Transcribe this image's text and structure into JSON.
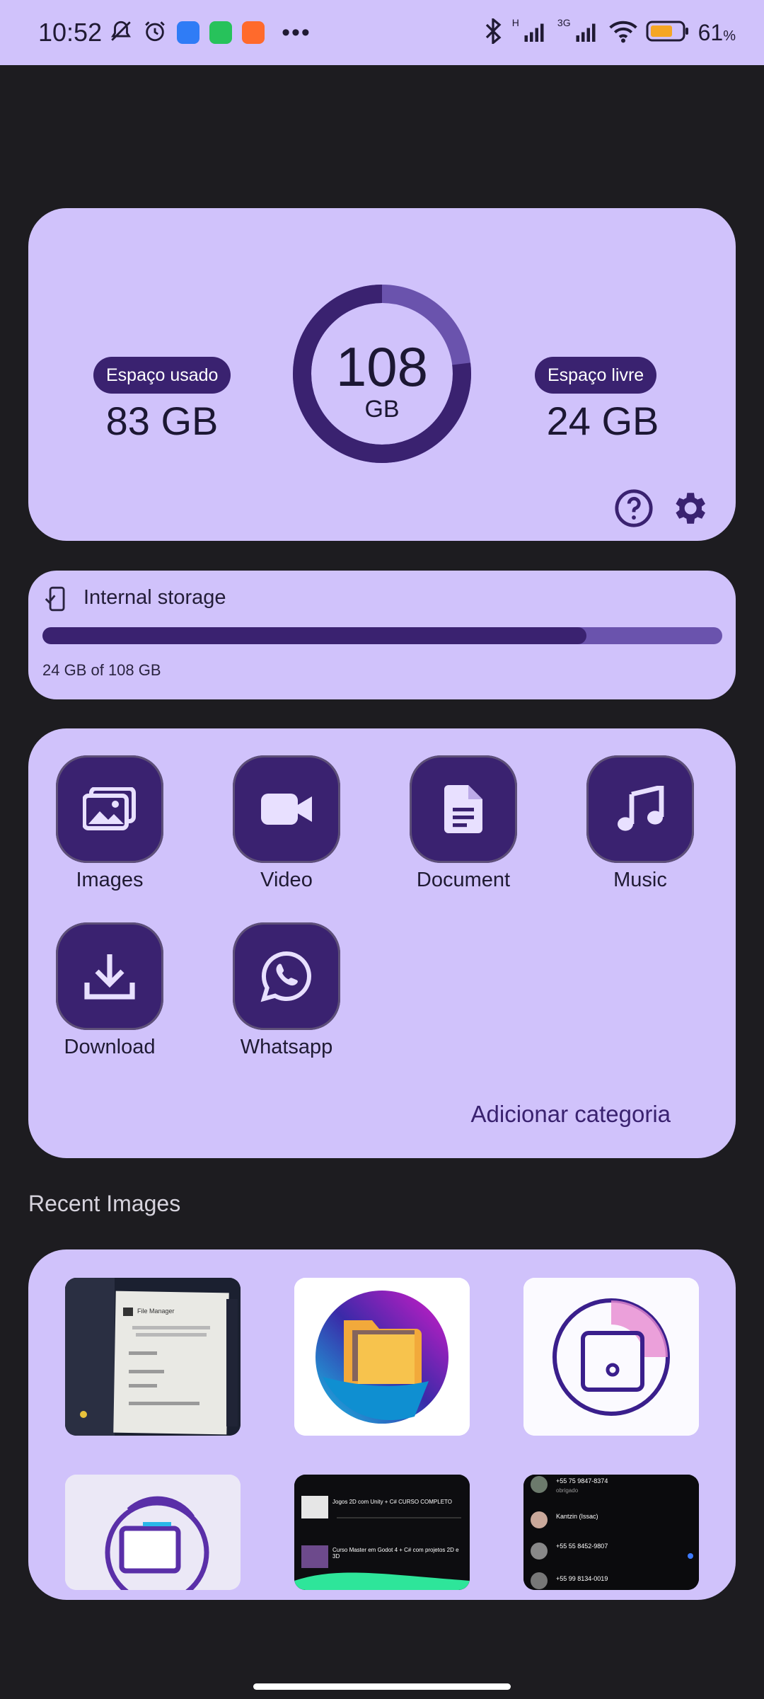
{
  "status_bar": {
    "time": "10:52",
    "network_1": "H",
    "network_2": "3G",
    "battery_percent": "61",
    "battery_unit": "%",
    "icons": [
      "mute-bell-icon",
      "alarm-icon",
      "messages-app-icon",
      "pocket-app-icon",
      "video-app-icon",
      "more-dots-icon",
      "bluetooth-icon",
      "signal-icon",
      "signal-icon",
      "wifi-icon",
      "battery-icon"
    ]
  },
  "storage": {
    "used_label": "Espaço usado",
    "used_value": "83 GB",
    "free_label": "Espaço livre",
    "free_value": "24 GB",
    "total_value": "108",
    "total_unit": "GB",
    "used_fraction": 0.77
  },
  "internal": {
    "title": "Internal storage",
    "subtitle": "24 GB of 108 GB",
    "fill_fraction": 0.8
  },
  "categories": [
    {
      "label": "Images",
      "icon": "images-icon"
    },
    {
      "label": "Video",
      "icon": "video-icon"
    },
    {
      "label": "Document",
      "icon": "document-icon"
    },
    {
      "label": "Music",
      "icon": "music-icon"
    },
    {
      "label": "Download",
      "icon": "download-icon"
    },
    {
      "label": "Whatsapp",
      "icon": "whatsapp-icon"
    }
  ],
  "add_category": "Adicionar categoria",
  "recent": {
    "title": "Recent Images",
    "thumb_texts": {
      "t1_title": "File Manager",
      "t5_line1": "Jogos 2D com Unity + C# CURSO COMPLETO",
      "t5_line2": "Curso Master em Godot 4 + C# com projetos 2D e 3D",
      "t6_contact1": "+55 75 9847-8374",
      "t6_msg1": "obrigado",
      "t6_contact2": "Kantzin (Issac)",
      "t6_contact3": "+55 55 8452-9807",
      "t6_contact4": "+55 99 8134-0019"
    }
  },
  "colors": {
    "card": "#d0c2fb",
    "accent": "#3a2270",
    "background": "#1d1c20"
  }
}
